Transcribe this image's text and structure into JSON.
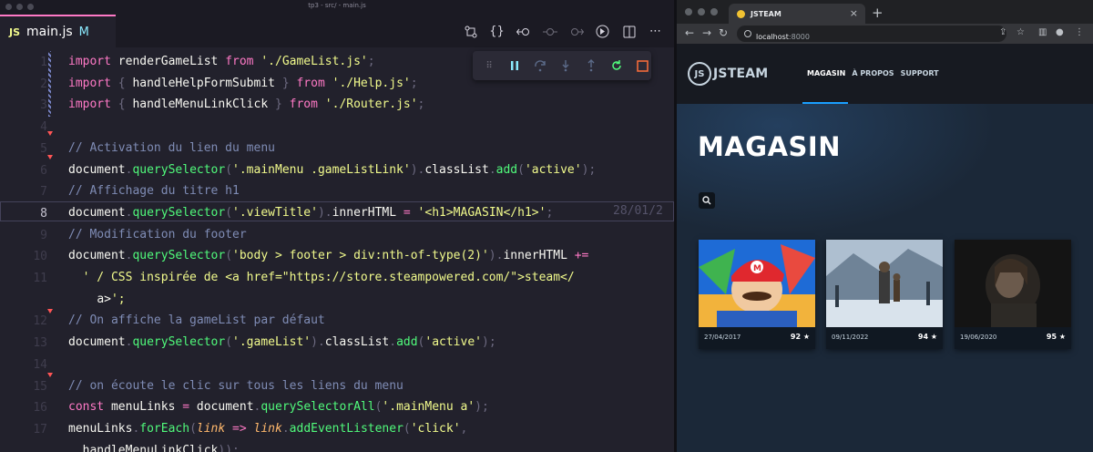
{
  "editor": {
    "window_title": "tp3 - src/ - main.js",
    "tab": {
      "badge": "JS",
      "filename": "main.js",
      "status": "M"
    },
    "actions": [
      "source-control-icon",
      "braces-icon",
      "go-back-icon",
      "dot-icon",
      "go-forward-icon",
      "debug-icon",
      "split-editor-icon",
      "more-icon"
    ],
    "debug_toolbar": [
      "drag-handle-icon",
      "pause-icon",
      "step-over-icon",
      "step-into-icon",
      "step-out-icon",
      "restart-icon",
      "stop-icon"
    ],
    "current_line_number": "8",
    "blame": "28/01/2",
    "lines": [
      "import renderGameList from './GameList.js';",
      "import { handleHelpFormSubmit } from './Help.js';",
      "import { handleMenuLinkClick } from './Router.js';",
      "",
      "// Activation du lien du menu",
      "document.querySelector('.mainMenu .gameListLink').classList.add('active');",
      "// Affichage du titre h1",
      "document.querySelector('.viewTitle').innerHTML = '<h1>MAGASIN</h1>';",
      "// Modification du footer",
      "document.querySelector('body > footer > div:nth-of-type(2)').innerHTML +=",
      "  ' / CSS inspirée de <a href=\"https://store.steampowered.com/\">steam</",
      "    a>';",
      "// On affiche la gameList par défaut",
      "document.querySelector('.gameList').classList.add('active');",
      "",
      "// on écoute le clic sur tous les liens du menu",
      "const menuLinks = document.querySelectorAll('.mainMenu a');",
      "menuLinks.forEach(link => link.addEventListener('click',",
      "  handleMenuLinkClick));"
    ]
  },
  "browser": {
    "tab_title": "JSTEAM",
    "url_host": "localhost",
    "url_port": ":8000",
    "site": {
      "logo_mark": "JS",
      "logo_text": "JSTEAM",
      "menu": [
        {
          "label": "MAGASIN",
          "active": true
        },
        {
          "label": "À PROPOS",
          "active": false
        },
        {
          "label": "SUPPORT",
          "active": false
        }
      ],
      "title": "MAGASIN",
      "games": [
        {
          "date": "27/04/2017",
          "score": "92",
          "star": "★"
        },
        {
          "date": "09/11/2022",
          "score": "94",
          "star": "★"
        },
        {
          "date": "19/06/2020",
          "score": "95",
          "star": "★"
        }
      ]
    }
  },
  "colors": {
    "accent": "#ff79c6",
    "link_blue": "#1a9fff",
    "steam_bg": "#1b2838"
  }
}
